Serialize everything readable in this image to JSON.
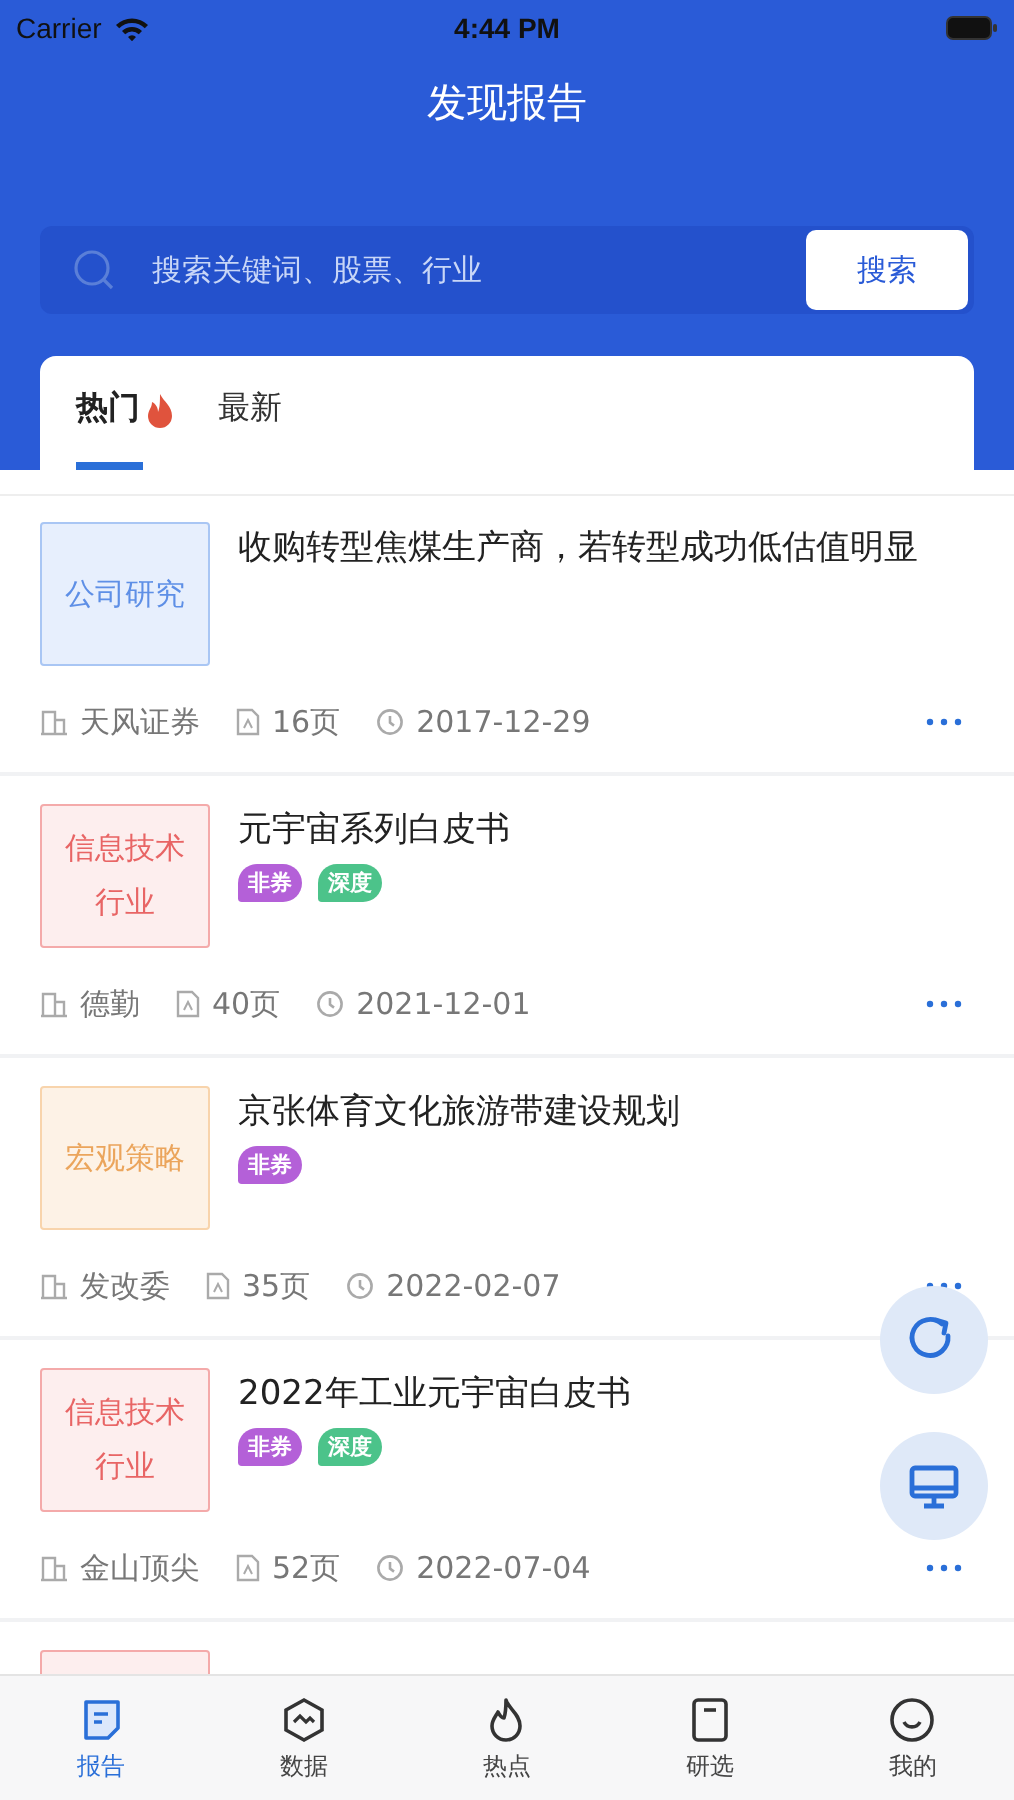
{
  "status_bar": {
    "carrier": "Carrier",
    "time": "4:44 PM"
  },
  "header": {
    "title": "发现报告"
  },
  "search": {
    "placeholder": "搜索关键词、股票、行业",
    "button": "搜索"
  },
  "tabs": [
    {
      "label": "热门",
      "selected": true,
      "hot": true
    },
    {
      "label": "最新",
      "selected": false,
      "hot": false
    }
  ],
  "reports": [
    {
      "category": "公司研究",
      "kind": "company",
      "title": "收购转型焦煤生产商，若转型成功低估值明显",
      "source": "天风证券",
      "pages": "16页",
      "date": "2017-12-29"
    },
    {
      "category": "信息技术行业",
      "kind": "industry",
      "title": "元宇宙系列白皮书",
      "tags": [
        {
          "label": "非券",
          "color": "#b460d8"
        },
        {
          "label": "深度",
          "color": "#4cc38a"
        }
      ],
      "source": "德勤",
      "pages": "40页",
      "date": "2021-12-01"
    },
    {
      "category": "宏观策略",
      "kind": "macro",
      "title": "京张体育文化旅游带建设规划",
      "tags": [
        {
          "label": "非券",
          "color": "#b460d8"
        }
      ],
      "source": "发改委",
      "pages": "35页",
      "date": "2022-02-07"
    },
    {
      "category": "信息技术行业",
      "kind": "industry",
      "title": "2022年工业元宇宙白皮书",
      "tags": [
        {
          "label": "非券",
          "color": "#b460d8"
        },
        {
          "label": "深度",
          "color": "#4cc38a"
        }
      ],
      "source": "金山顶尖",
      "pages": "52页",
      "date": "2022-07-04"
    },
    {
      "kind": "industry"
    }
  ],
  "tab_bar": [
    {
      "label": "报告",
      "selected": true
    },
    {
      "label": "数据",
      "selected": false
    },
    {
      "label": "热点",
      "selected": false
    },
    {
      "label": "研选",
      "selected": false
    },
    {
      "label": "我的",
      "selected": false
    }
  ]
}
